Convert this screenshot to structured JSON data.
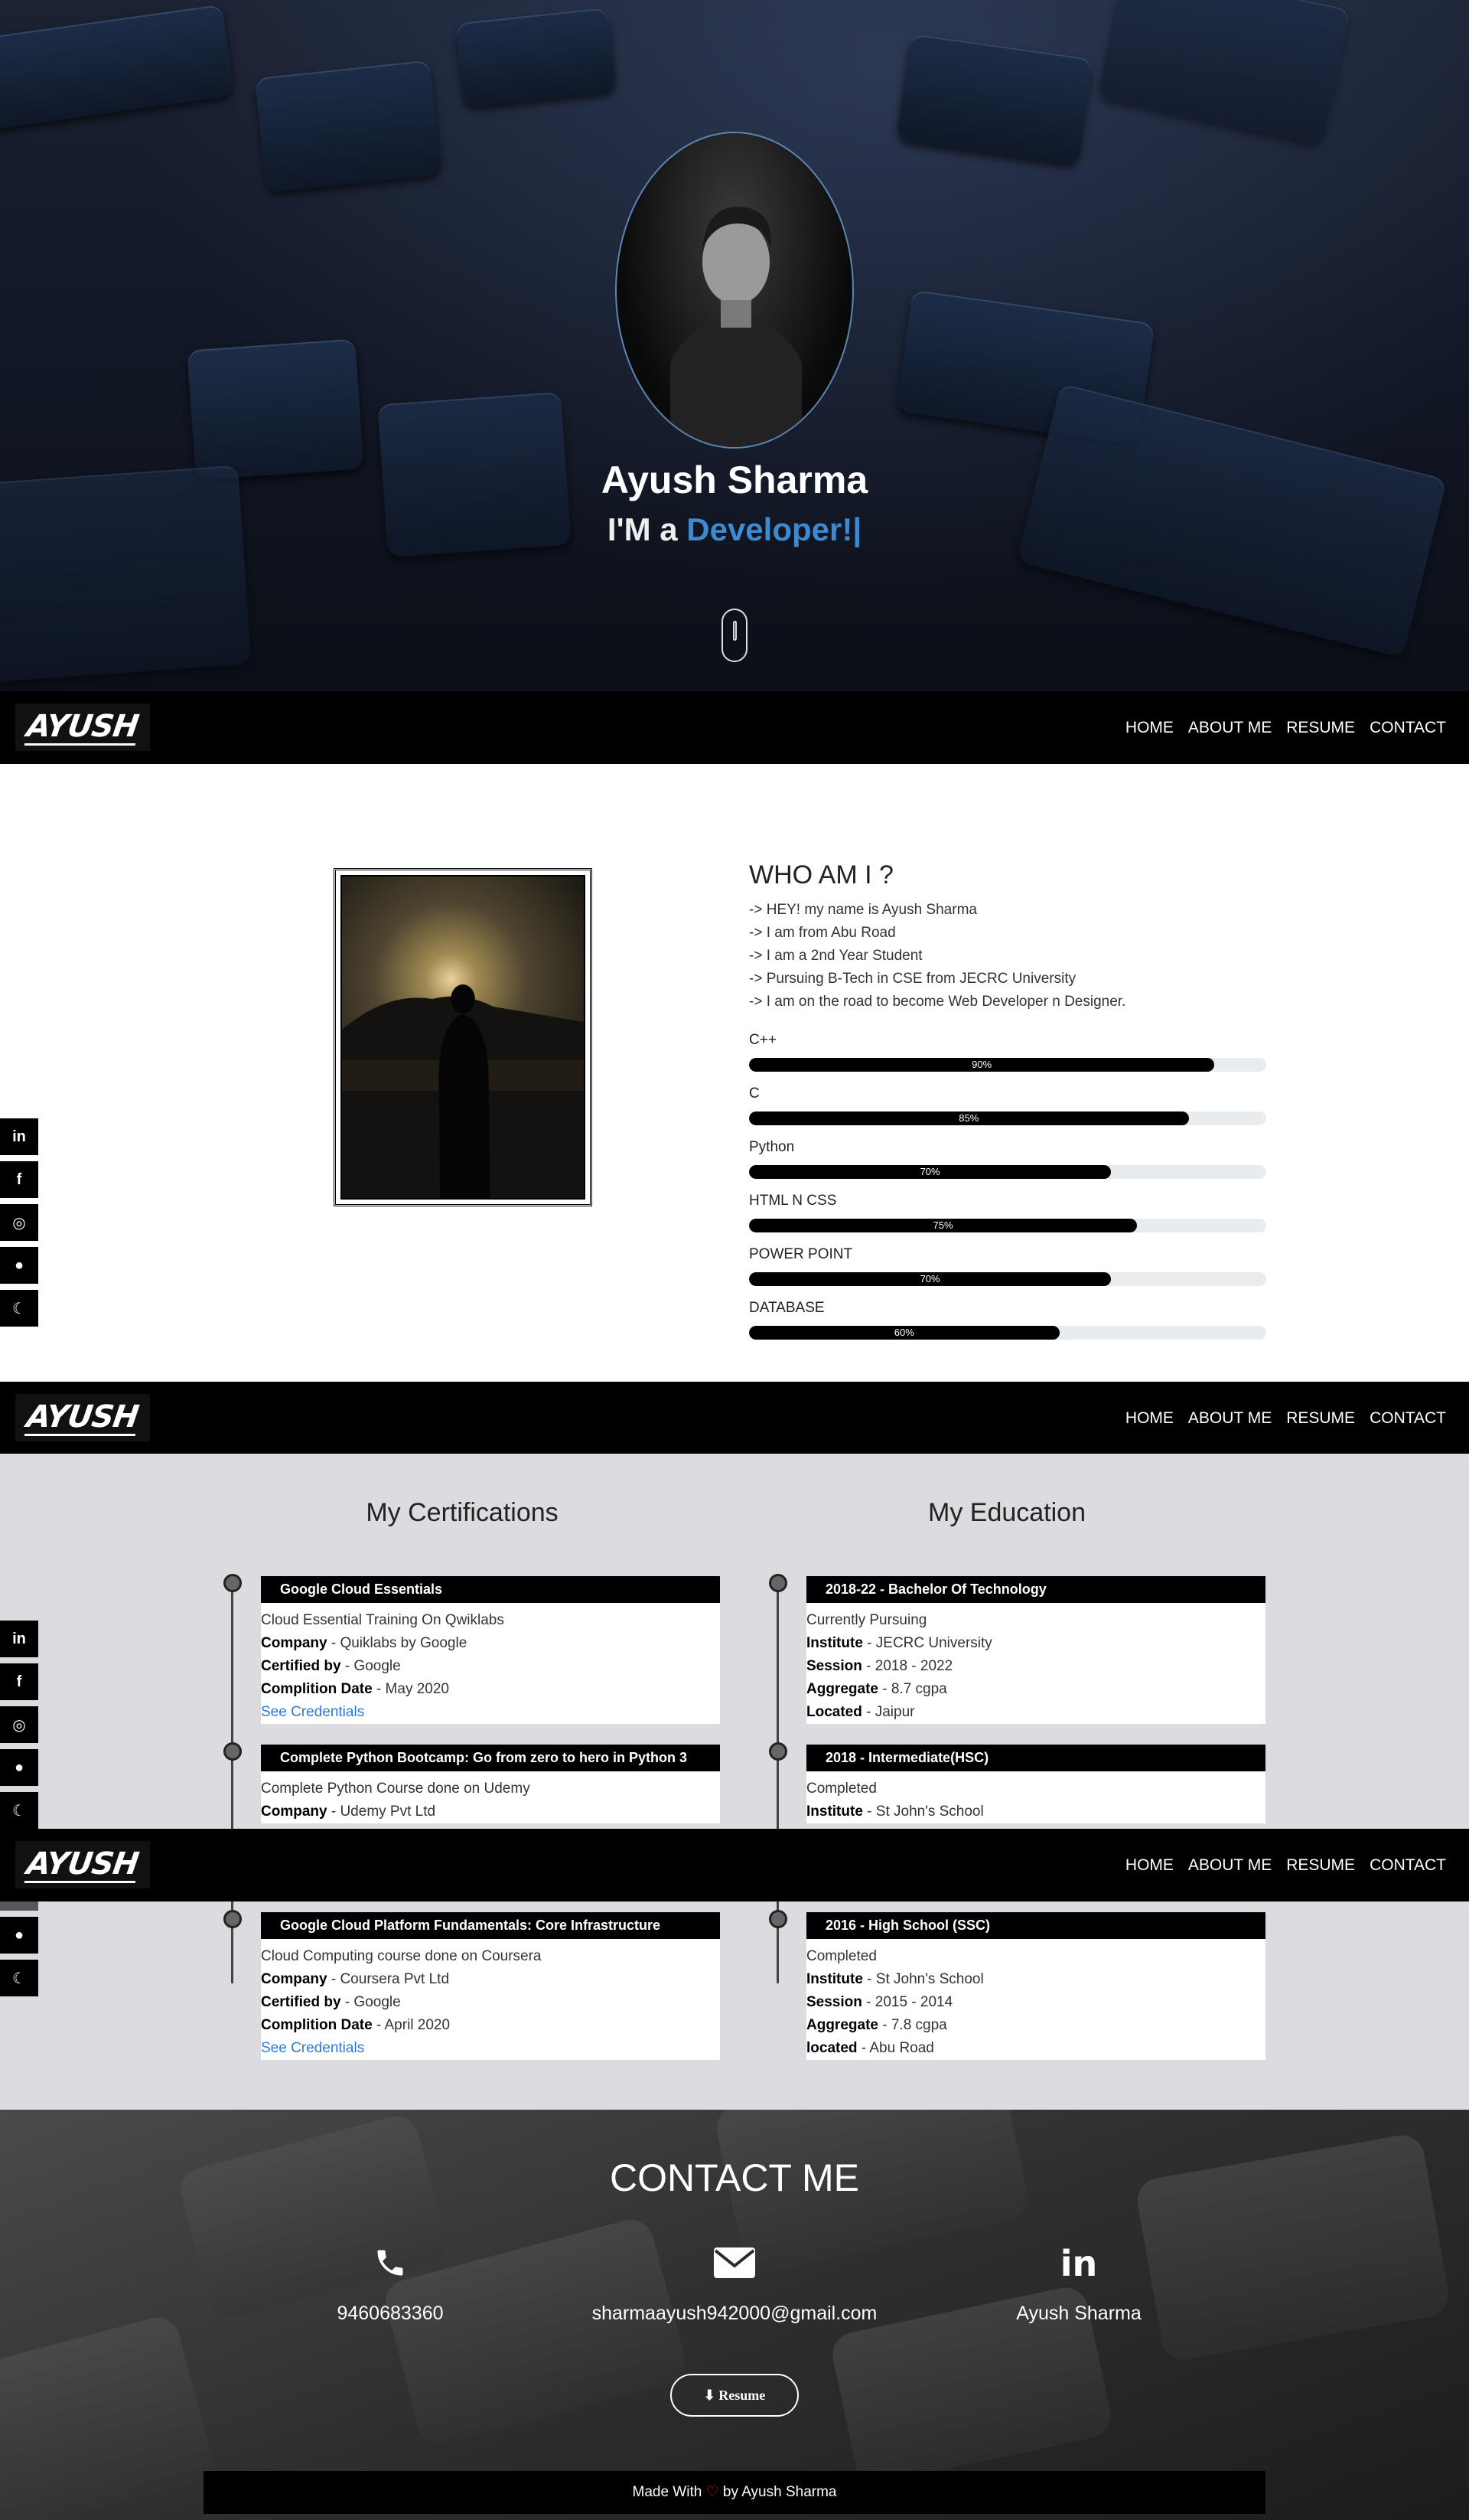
{
  "nav": {
    "logo": "AYUSH",
    "links": [
      "HOME",
      "ABOUT ME",
      "RESUME",
      "CONTACT"
    ]
  },
  "hero": {
    "name": "Ayush Sharma",
    "tag_prefix": "I'M a ",
    "tag_accent": "Developer!|"
  },
  "social": {
    "icons": [
      "linkedin-icon",
      "facebook-icon",
      "instagram-icon",
      "github-icon",
      "moon-icon"
    ],
    "glyphs": [
      "in",
      "f",
      "◎",
      "●",
      "☾"
    ]
  },
  "about": {
    "title": "WHO AM I ?",
    "lines": [
      "-> HEY! my name is Ayush Sharma",
      "-> I am from Abu Road",
      "-> I am a 2nd Year Student",
      "-> Pursuing B-Tech in CSE from JECRC University",
      "-> I am on the road to become Web Developer n Designer."
    ],
    "skills": [
      {
        "name": "C++",
        "percent": 90,
        "label": "90%"
      },
      {
        "name": "C",
        "percent": 85,
        "label": "85%"
      },
      {
        "name": "Python",
        "percent": 70,
        "label": "70%"
      },
      {
        "name": "HTML N CSS",
        "percent": 75,
        "label": "75%"
      },
      {
        "name": "POWER POINT",
        "percent": 70,
        "label": "70%"
      },
      {
        "name": "DATABASE",
        "percent": 60,
        "label": "60%"
      }
    ]
  },
  "resume": {
    "cert_title": "My Certifications",
    "edu_title": "My Education",
    "certs": [
      {
        "header": "Google Cloud Essentials",
        "desc": "Cloud Essential Training On Qwiklabs",
        "fields": [
          [
            "Company",
            " - Quiklabs by Google"
          ],
          [
            "Certified by",
            " - Google"
          ],
          [
            "Complition Date",
            " - May 2020"
          ]
        ],
        "link": "See Credentials"
      },
      {
        "header": "Complete Python Bootcamp: Go from zero to hero in Python 3",
        "desc": "Complete Python Course done on Udemy",
        "fields": [
          [
            "Company",
            " - Udemy Pvt Ltd"
          ]
        ],
        "link": ""
      },
      {
        "header": "Google Cloud Platform Fundamentals: Core Infrastructure",
        "desc": "Cloud Computing course done on Coursera",
        "fields": [
          [
            "Company",
            " - Coursera Pvt Ltd"
          ],
          [
            "Certified by",
            " - Google"
          ],
          [
            "Complition Date",
            " - April 2020"
          ]
        ],
        "link": "See Credentials"
      }
    ],
    "edu": [
      {
        "header": "2018-22 - Bachelor Of Technology",
        "desc": "Currently Pursuing",
        "fields": [
          [
            "Institute",
            " - JECRC University"
          ],
          [
            "Session",
            " - 2018 - 2022"
          ],
          [
            "Aggregate",
            " - 8.7 cgpa"
          ],
          [
            "Located",
            " - Jaipur"
          ]
        ]
      },
      {
        "header": "2018 - Intermediate(HSC)",
        "desc": "Completed",
        "fields": [
          [
            "Institute",
            " - St John's School"
          ]
        ]
      },
      {
        "header": "2016 - High School (SSC)",
        "desc": "Completed",
        "fields": [
          [
            "Institute",
            " - St John's School"
          ],
          [
            "Session",
            " - 2015 - 2014"
          ],
          [
            "Aggregate",
            " - 7.8 cgpa"
          ],
          [
            "located",
            " - Abu Road"
          ]
        ]
      }
    ]
  },
  "contact": {
    "title": "CONTACT ME",
    "phone": "9460683360",
    "email": "sharmaayush942000@gmail.com",
    "linkedin": "Ayush Sharma",
    "resume_btn": "⬇ Resume",
    "footer_prefix": "Made With ",
    "footer_heart": "♡",
    "footer_suffix": " by Ayush Sharma"
  }
}
